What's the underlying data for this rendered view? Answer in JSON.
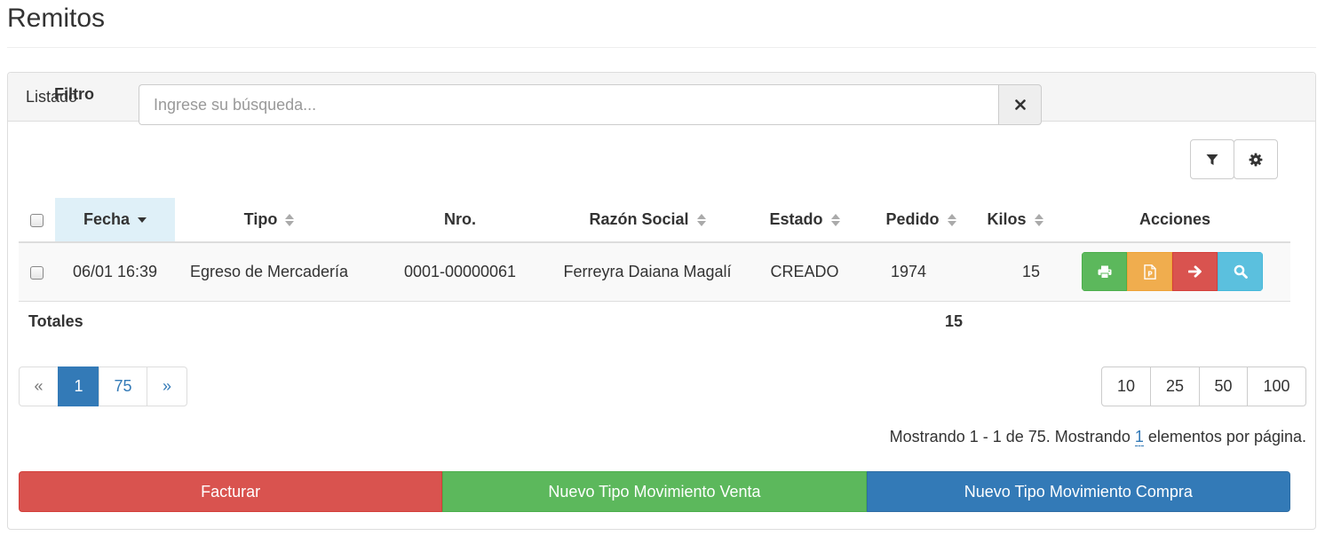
{
  "page": {
    "title": "Remitos"
  },
  "panel": {
    "heading": "Listado"
  },
  "filter": {
    "label": "Filtro",
    "placeholder": "Ingrese su búsqueda...",
    "value": ""
  },
  "toolbar": {
    "filter_icon": "funnel-icon",
    "settings_icon": "gear-icon"
  },
  "table": {
    "columns": {
      "fecha": "Fecha",
      "tipo": "Tipo",
      "nro": "Nro.",
      "razon_social": "Razón Social",
      "estado": "Estado",
      "pedido": "Pedido",
      "kilos": "Kilos",
      "acciones": "Acciones"
    },
    "sorted_column": "Fecha",
    "rows": [
      {
        "fecha": "06/01 16:39",
        "tipo": "Egreso de Mercadería",
        "nro": "0001-00000061",
        "razon_social": "Ferreyra Daiana Magalí",
        "estado": "CREADO",
        "pedido": "1974",
        "kilos": "15",
        "actions": [
          "print-icon",
          "pdf-icon",
          "arrow-right-icon",
          "search-icon"
        ]
      }
    ],
    "totals": {
      "label": "Totales",
      "kilos": "15"
    }
  },
  "pagination": {
    "prev": "«",
    "pages": [
      "1",
      "75"
    ],
    "current": "1",
    "next": "»"
  },
  "page_sizes": [
    "10",
    "25",
    "50",
    "100"
  ],
  "summary": {
    "prefix": "Mostrando 1 - 1 de 75. Mostrando",
    "per_page": "1",
    "suffix": "elementos por página."
  },
  "buttons": {
    "invoice": "Facturar",
    "new_sale_type": "Nuevo Tipo Movimiento Venta",
    "new_purchase_type": "Nuevo Tipo Movimiento Compra"
  },
  "colors": {
    "primary": "#337ab7",
    "success": "#5cb85c",
    "warning": "#f0ad4e",
    "danger": "#d9534f",
    "info": "#5bc0de",
    "sorted_header": "#dff0f8"
  }
}
